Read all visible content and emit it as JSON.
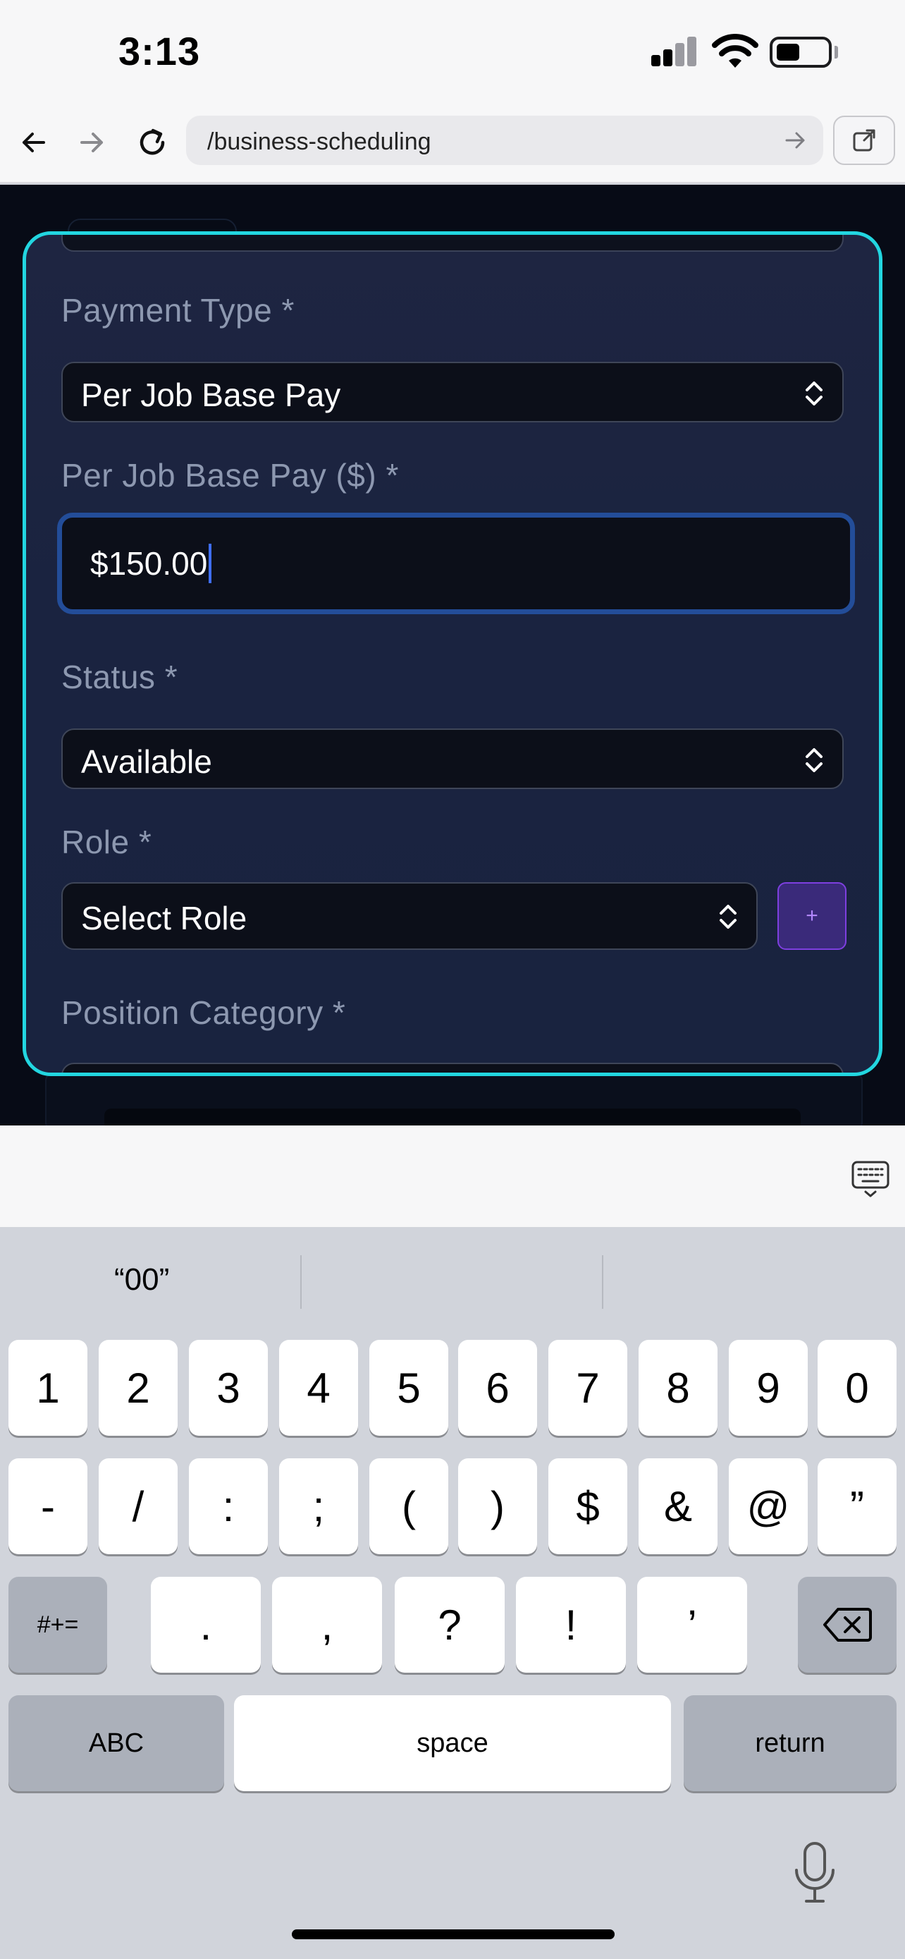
{
  "status_bar": {
    "time": "3:13"
  },
  "browser": {
    "url": "/business-scheduling"
  },
  "form": {
    "payment_type": {
      "label": "Payment Type *",
      "value": "Per Job Base Pay"
    },
    "base_pay": {
      "label": "Per Job Base Pay ($) *",
      "value": "$150.00"
    },
    "status": {
      "label": "Status *",
      "value": "Available"
    },
    "role": {
      "label": "Role *",
      "value": "Select Role",
      "add_label": "+"
    },
    "position_category": {
      "label": "Position Category *"
    }
  },
  "keyboard": {
    "suggestion": "“00”",
    "row1": [
      "1",
      "2",
      "3",
      "4",
      "5",
      "6",
      "7",
      "8",
      "9",
      "0"
    ],
    "row2": [
      "-",
      "/",
      ":",
      ";",
      "(",
      ")",
      "$",
      "&",
      "@",
      "”"
    ],
    "row3": [
      "#+=",
      ".",
      ",",
      "?",
      "!",
      "’"
    ],
    "abc": "ABC",
    "space": "space",
    "return": "return"
  },
  "colors": {
    "modal_border": "#22d6e0",
    "focus_border": "#234d99",
    "add_button": "#7e3fe0"
  }
}
